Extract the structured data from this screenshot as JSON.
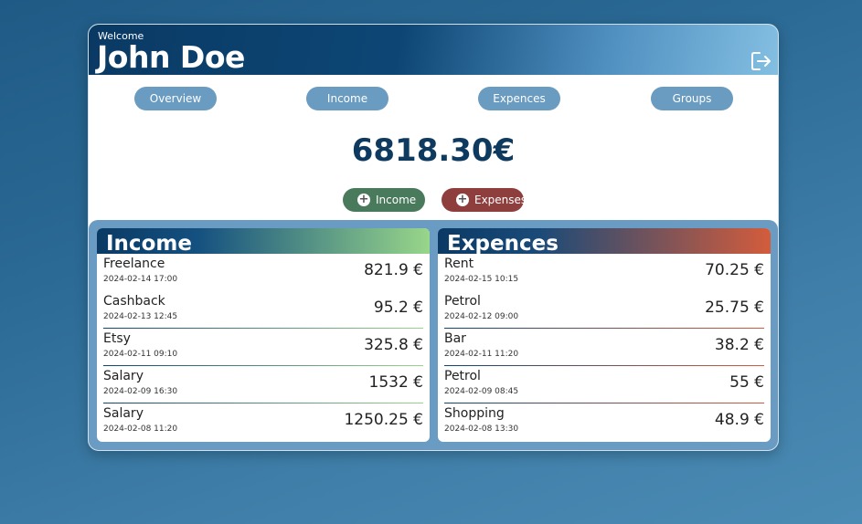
{
  "header": {
    "welcome": "Welcome",
    "username": "John Doe",
    "logout_icon": "logout-icon"
  },
  "nav": [
    {
      "label": "Overview"
    },
    {
      "label": "Income"
    },
    {
      "label": "Expences"
    },
    {
      "label": "Groups"
    }
  ],
  "balance": "6818.30€",
  "actions": {
    "add_income": "Income",
    "add_expenses": "Expenses",
    "plus_icon": "plus-circle-icon",
    "income_color": "#4a7a5c",
    "expenses_color": "#8f3e3e"
  },
  "income": {
    "title": "Income",
    "accent": "#98d68a",
    "items": [
      {
        "name": "Freelance",
        "date": "2024-02-14 17:00",
        "amount": "821.9 €"
      },
      {
        "name": "Cashback",
        "date": "2024-02-13 12:45",
        "amount": "95.2 €"
      },
      {
        "name": "Etsy",
        "date": "2024-02-11 09:10",
        "amount": "325.8 €"
      },
      {
        "name": "Salary",
        "date": "2024-02-09 16:30",
        "amount": "1532 €"
      },
      {
        "name": "Salary",
        "date": "2024-02-08 11:20",
        "amount": "1250.25 €"
      }
    ]
  },
  "expenses": {
    "title": "Expences",
    "accent": "#d35c3c",
    "items": [
      {
        "name": "Rent",
        "date": "2024-02-15 10:15",
        "amount": "70.25 €"
      },
      {
        "name": "Petrol",
        "date": "2024-02-12 09:00",
        "amount": "25.75 €"
      },
      {
        "name": "Bar",
        "date": "2024-02-11 11:20",
        "amount": "38.2 €"
      },
      {
        "name": "Petrol",
        "date": "2024-02-09 08:45",
        "amount": "55 €"
      },
      {
        "name": "Shopping",
        "date": "2024-02-08 13:30",
        "amount": "48.9 €"
      }
    ]
  }
}
